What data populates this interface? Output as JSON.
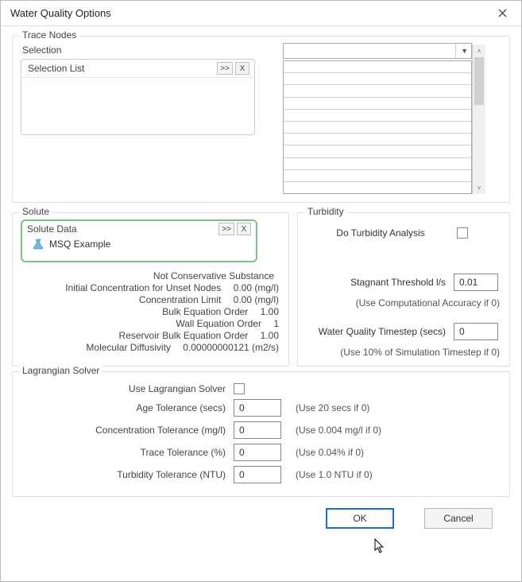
{
  "window": {
    "title": "Water Quality Options"
  },
  "trace": {
    "legend": "Trace Nodes",
    "selection_label": "Selection",
    "selection_list_label": "Selection List",
    "combo_value": ""
  },
  "solute": {
    "legend": "Solute",
    "box_label": "Solute Data",
    "item": "MSQ Example",
    "props": {
      "conservative_k": "Not Conservative Substance",
      "conservative_v": "",
      "init_conc_k": "Initial Concentration for Unset Nodes",
      "init_conc_v": "0.00 (mg/l)",
      "conc_limit_k": "Concentration Limit",
      "conc_limit_v": "0.00 (mg/l)",
      "bulk_order_k": "Bulk Equation Order",
      "bulk_order_v": "1.00",
      "wall_order_k": "Wall Equation Order",
      "wall_order_v": "1",
      "res_bulk_k": "Reservoir Bulk Equation Order",
      "res_bulk_v": "1.00",
      "mol_diff_k": "Molecular Diffusivity",
      "mol_diff_v": "0.00000000121 (m2/s)"
    }
  },
  "turbidity": {
    "legend": "Turbidity",
    "do_analysis_label": "Do Turbidity Analysis",
    "do_analysis_checked": false,
    "stagnant_label": "Stagnant Threshold l/s",
    "stagnant_value": "0.01",
    "stagnant_hint": "(Use Computational Accuracy if 0)",
    "timestep_label": "Water Quality Timestep (secs)",
    "timestep_value": "0",
    "timestep_hint": "(Use 10% of Simulation Timestep if 0)"
  },
  "lagrangian": {
    "legend": "Lagrangian Solver",
    "use_label": "Use Lagrangian Solver",
    "use_checked": false,
    "age_label": "Age Tolerance (secs)",
    "age_value": "0",
    "age_hint": "(Use 20 secs if 0)",
    "conc_label": "Concentration Tolerance (mg/l)",
    "conc_value": "0",
    "conc_hint": "(Use 0.004 mg/l if 0)",
    "trace_label": "Trace Tolerance (%)",
    "trace_value": "0",
    "trace_hint": "(Use 0.04% if 0)",
    "turb_label": "Turbidity Tolerance (NTU)",
    "turb_value": "0",
    "turb_hint": "(Use 1.0 NTU if 0)"
  },
  "buttons": {
    "ok": "OK",
    "cancel": "Cancel"
  },
  "glyphs": {
    "expand": ">>",
    "clear": "X"
  }
}
